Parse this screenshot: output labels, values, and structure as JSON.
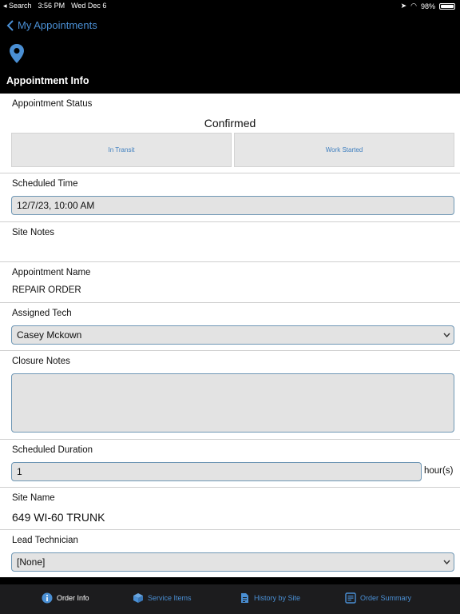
{
  "statusbar": {
    "carrier": "◂ Search",
    "time": "3:56 PM",
    "date": "Wed Dec 6",
    "battery": "98%"
  },
  "header": {
    "back_label": "My Appointments",
    "title": "Appointment Info"
  },
  "status": {
    "label": "Appointment  Status",
    "value": "Confirmed",
    "btn_in_transit": "In Transit",
    "btn_work_started": "Work Started"
  },
  "scheduled_time": {
    "label": "Scheduled Time",
    "value": "12/7/23, 10:00 AM"
  },
  "site_notes": {
    "label": "Site Notes"
  },
  "appointment_name": {
    "label": "Appointment Name",
    "value": "REPAIR ORDER"
  },
  "assigned_tech": {
    "label": "Assigned  Tech",
    "value": "Casey Mckown"
  },
  "closure_notes": {
    "label": "Closure Notes",
    "value": ""
  },
  "scheduled_duration": {
    "label": "Scheduled Duration",
    "value": "1",
    "unit": "hour(s)"
  },
  "site_name": {
    "label": "Site Name",
    "value": "649 WI-60 TRUNK"
  },
  "lead_technician": {
    "label": "Lead Technician",
    "value": "[None]"
  },
  "tabs": [
    {
      "label": "Order Info",
      "icon": "info-icon",
      "active": true
    },
    {
      "label": "Service Items",
      "icon": "box-icon",
      "active": false
    },
    {
      "label": "History by Site",
      "icon": "document-icon",
      "active": false
    },
    {
      "label": "Order  Summary",
      "icon": "list-document-icon",
      "active": false
    }
  ],
  "colors": {
    "accent": "#4a8fd4",
    "header_bg": "#000000",
    "field_bg": "#e3e3e3",
    "field_border": "#6f97b5"
  }
}
